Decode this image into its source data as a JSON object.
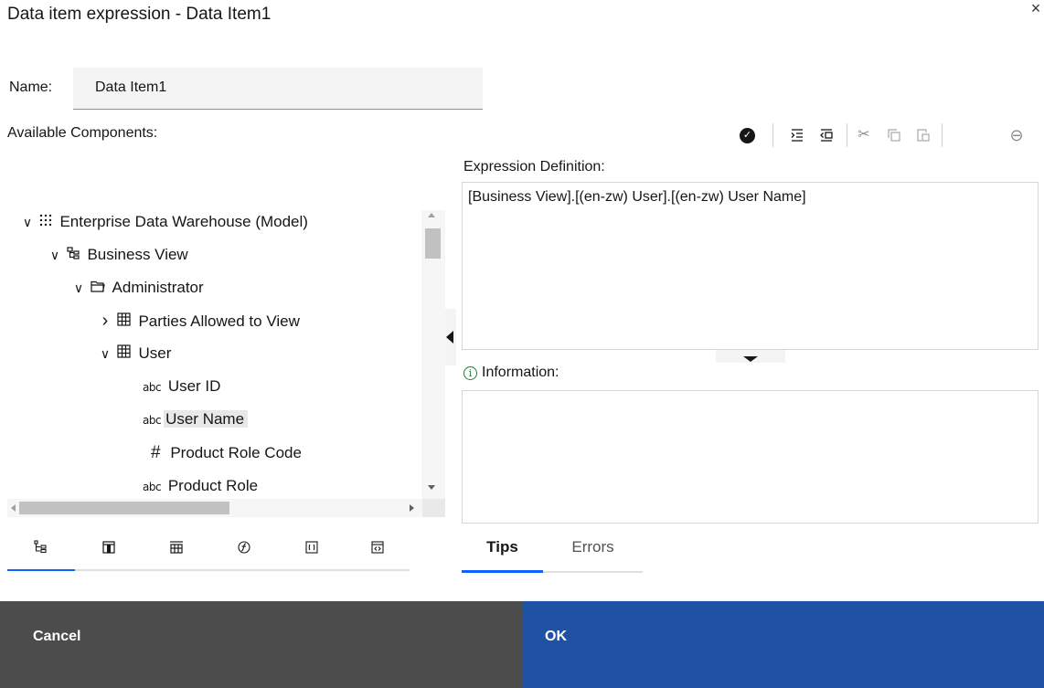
{
  "dialog": {
    "title": "Data item expression - Data Item1",
    "close_icon": "×"
  },
  "name_field": {
    "label": "Name:",
    "value": "Data Item1"
  },
  "available_components_label": "Available Components:",
  "toolbar": {
    "validate_icon": "✓",
    "indent_icon": "indent-icon",
    "outdent_icon": "outdent-icon",
    "cut_icon": "✂",
    "copy_icon": "copy-icon",
    "paste_icon": "paste-icon",
    "remove_icon": "⊖"
  },
  "expression": {
    "label": "Expression Definition:",
    "text": "[Business View].[(en-zw) User].[(en-zw) User Name]"
  },
  "information": {
    "label": "Information:",
    "icon": "i"
  },
  "tree": {
    "items": [
      {
        "label": "Enterprise Data Warehouse (Model)",
        "icon": "model-icon",
        "chevron": "∨"
      },
      {
        "label": "Business View",
        "icon": "namespace-icon",
        "chevron": "∨"
      },
      {
        "label": "Administrator",
        "icon": "folder-icon",
        "chevron": "∨"
      },
      {
        "label": "Parties Allowed to View",
        "icon": "table-icon",
        "chevron": "›"
      },
      {
        "label": "User",
        "icon": "table-icon",
        "chevron": "∨"
      },
      {
        "label": "User ID",
        "icon": "abc"
      },
      {
        "label": "User Name",
        "icon": "abc"
      },
      {
        "label": "Product Role Code",
        "icon": "#"
      },
      {
        "label": "Product Role",
        "icon": "abc"
      }
    ]
  },
  "left_tabs": [
    {
      "name": "source-tab-icon"
    },
    {
      "name": "data-items-tab-icon"
    },
    {
      "name": "query-items-tab-icon"
    },
    {
      "name": "functions-tab-icon"
    },
    {
      "name": "parameters-tab-icon"
    },
    {
      "name": "macros-tab-icon"
    }
  ],
  "right_tabs": {
    "tips": "Tips",
    "errors": "Errors"
  },
  "footer": {
    "cancel": "Cancel",
    "ok": "OK"
  },
  "colors": {
    "ok_bg": "#1f52a3",
    "cancel_bg": "#4c4c4c",
    "active_tab": "#0f62fe",
    "info_icon": "#198038"
  }
}
